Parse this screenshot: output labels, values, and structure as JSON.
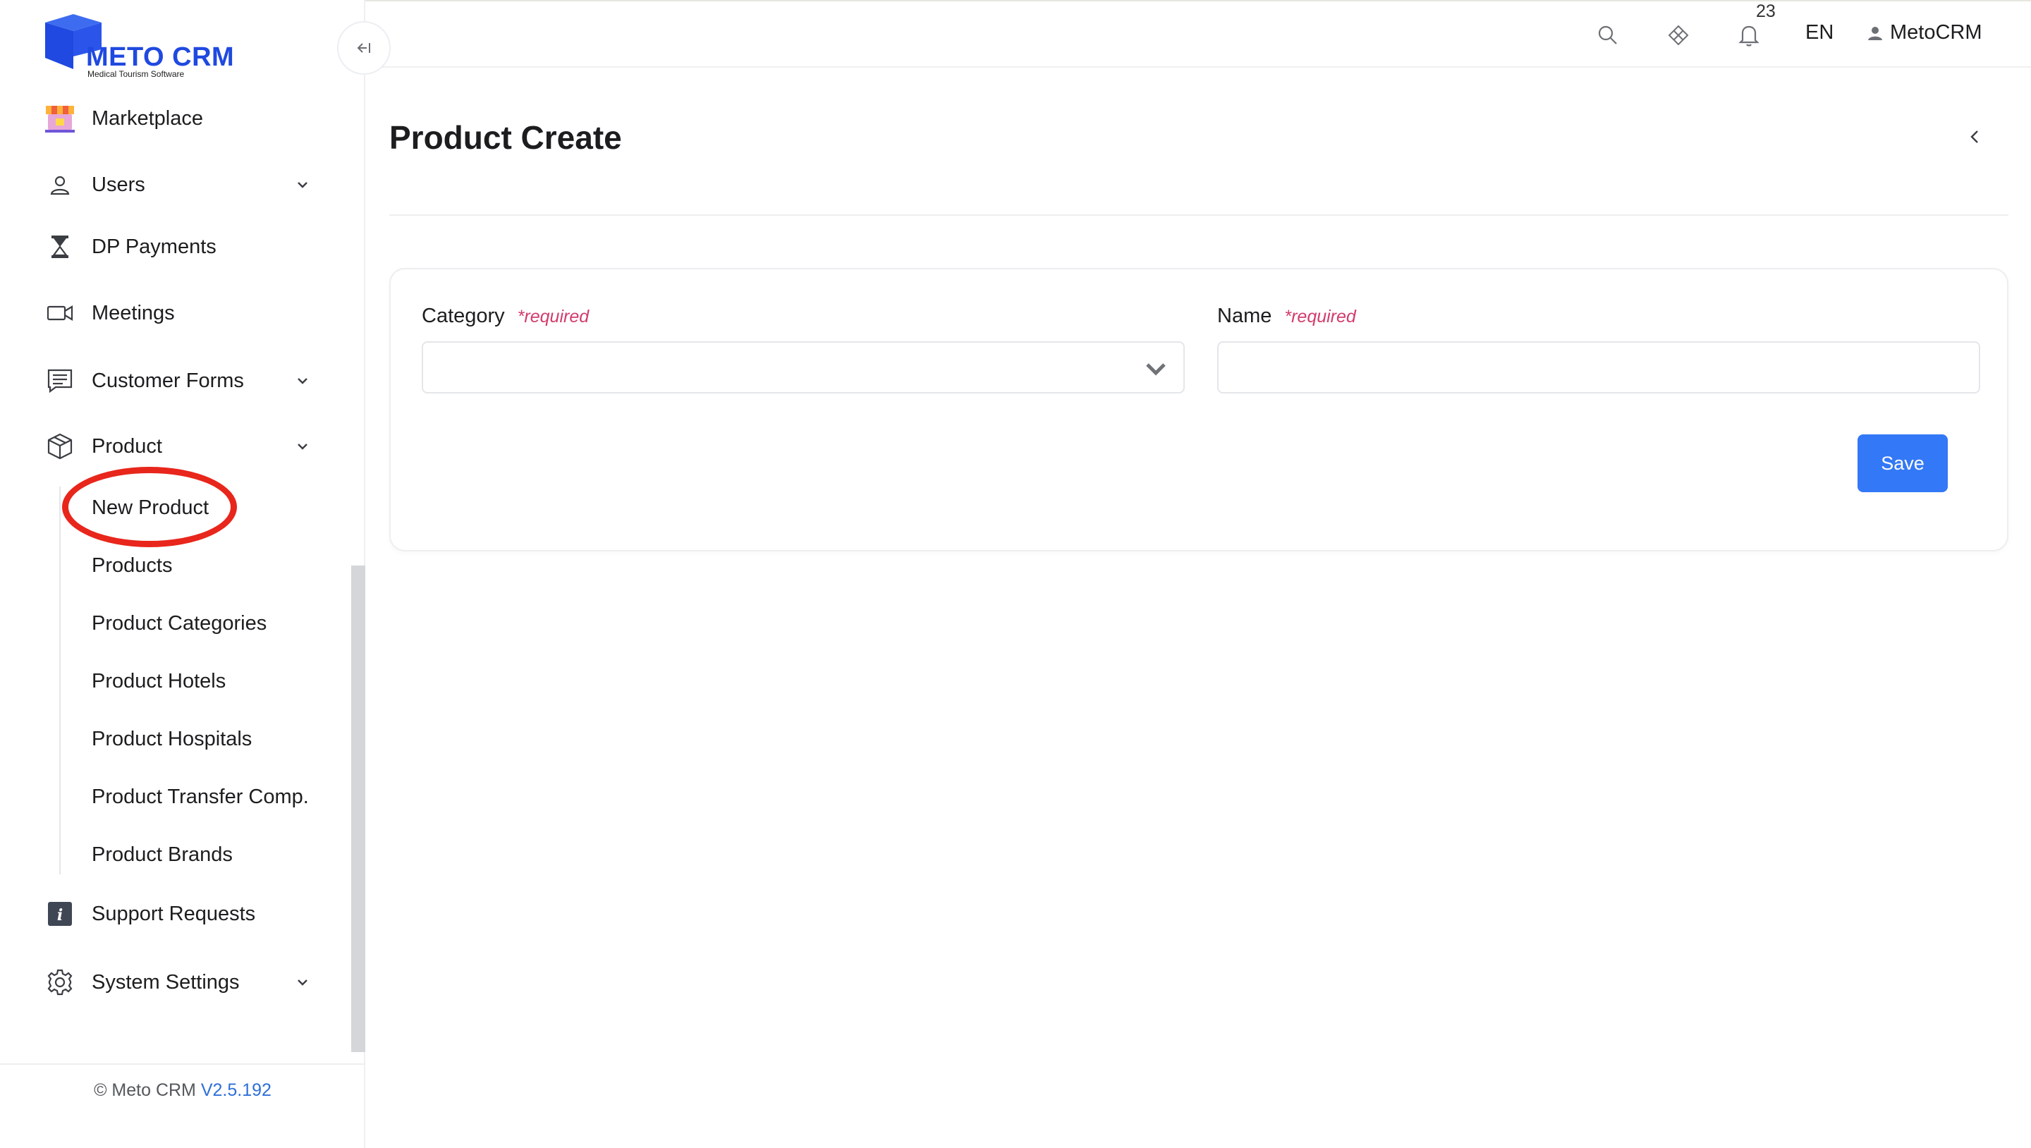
{
  "logo": {
    "name": "METO CRM",
    "tagline": "Medical Tourism Software",
    "brand_color": "#1f49e0"
  },
  "sidebar": {
    "collapse_icon": "collapse-left-icon",
    "items": [
      {
        "label": "Marketplace",
        "icon": "marketplace-store-icon",
        "has_children": false
      },
      {
        "label": "Users",
        "icon": "user-icon",
        "has_children": true
      },
      {
        "label": "DP Payments",
        "icon": "hourglass-icon",
        "has_children": false
      },
      {
        "label": "Meetings",
        "icon": "video-camera-icon",
        "has_children": false
      },
      {
        "label": "Customer Forms",
        "icon": "form-message-icon",
        "has_children": true
      },
      {
        "label": "Product",
        "icon": "box-icon",
        "has_children": true,
        "expanded": true
      },
      {
        "label": "Support Requests",
        "icon": "info-icon",
        "has_children": false
      },
      {
        "label": "System Settings",
        "icon": "gear-icon",
        "has_children": true
      }
    ],
    "product_children": [
      {
        "label": "New Product",
        "highlighted": true
      },
      {
        "label": "Products"
      },
      {
        "label": "Product Categories"
      },
      {
        "label": "Product Hotels"
      },
      {
        "label": "Product Hospitals"
      },
      {
        "label": "Product Transfer Comp."
      },
      {
        "label": "Product Brands"
      }
    ],
    "footer": {
      "prefix": "© Meto CRM",
      "version": "V2.5.192"
    }
  },
  "header": {
    "search_icon": "search-icon",
    "apps_icon": "diamond-grid-icon",
    "notification_icon": "bell-icon",
    "notification_count": "23",
    "language": "EN",
    "user_icon": "person-icon",
    "user_name": "MetoCRM"
  },
  "main": {
    "title": "Product Create",
    "back_icon": "chevron-left-icon",
    "form": {
      "category": {
        "label": "Category",
        "required_text": "*required",
        "value": ""
      },
      "name": {
        "label": "Name",
        "required_text": "*required",
        "value": "",
        "placeholder": ""
      },
      "save_label": "Save"
    }
  },
  "colors": {
    "primary_button": "#3378f6",
    "required": "#d23c6b",
    "highlight_ring": "#e8261b",
    "version_link": "#2e6fd9"
  }
}
